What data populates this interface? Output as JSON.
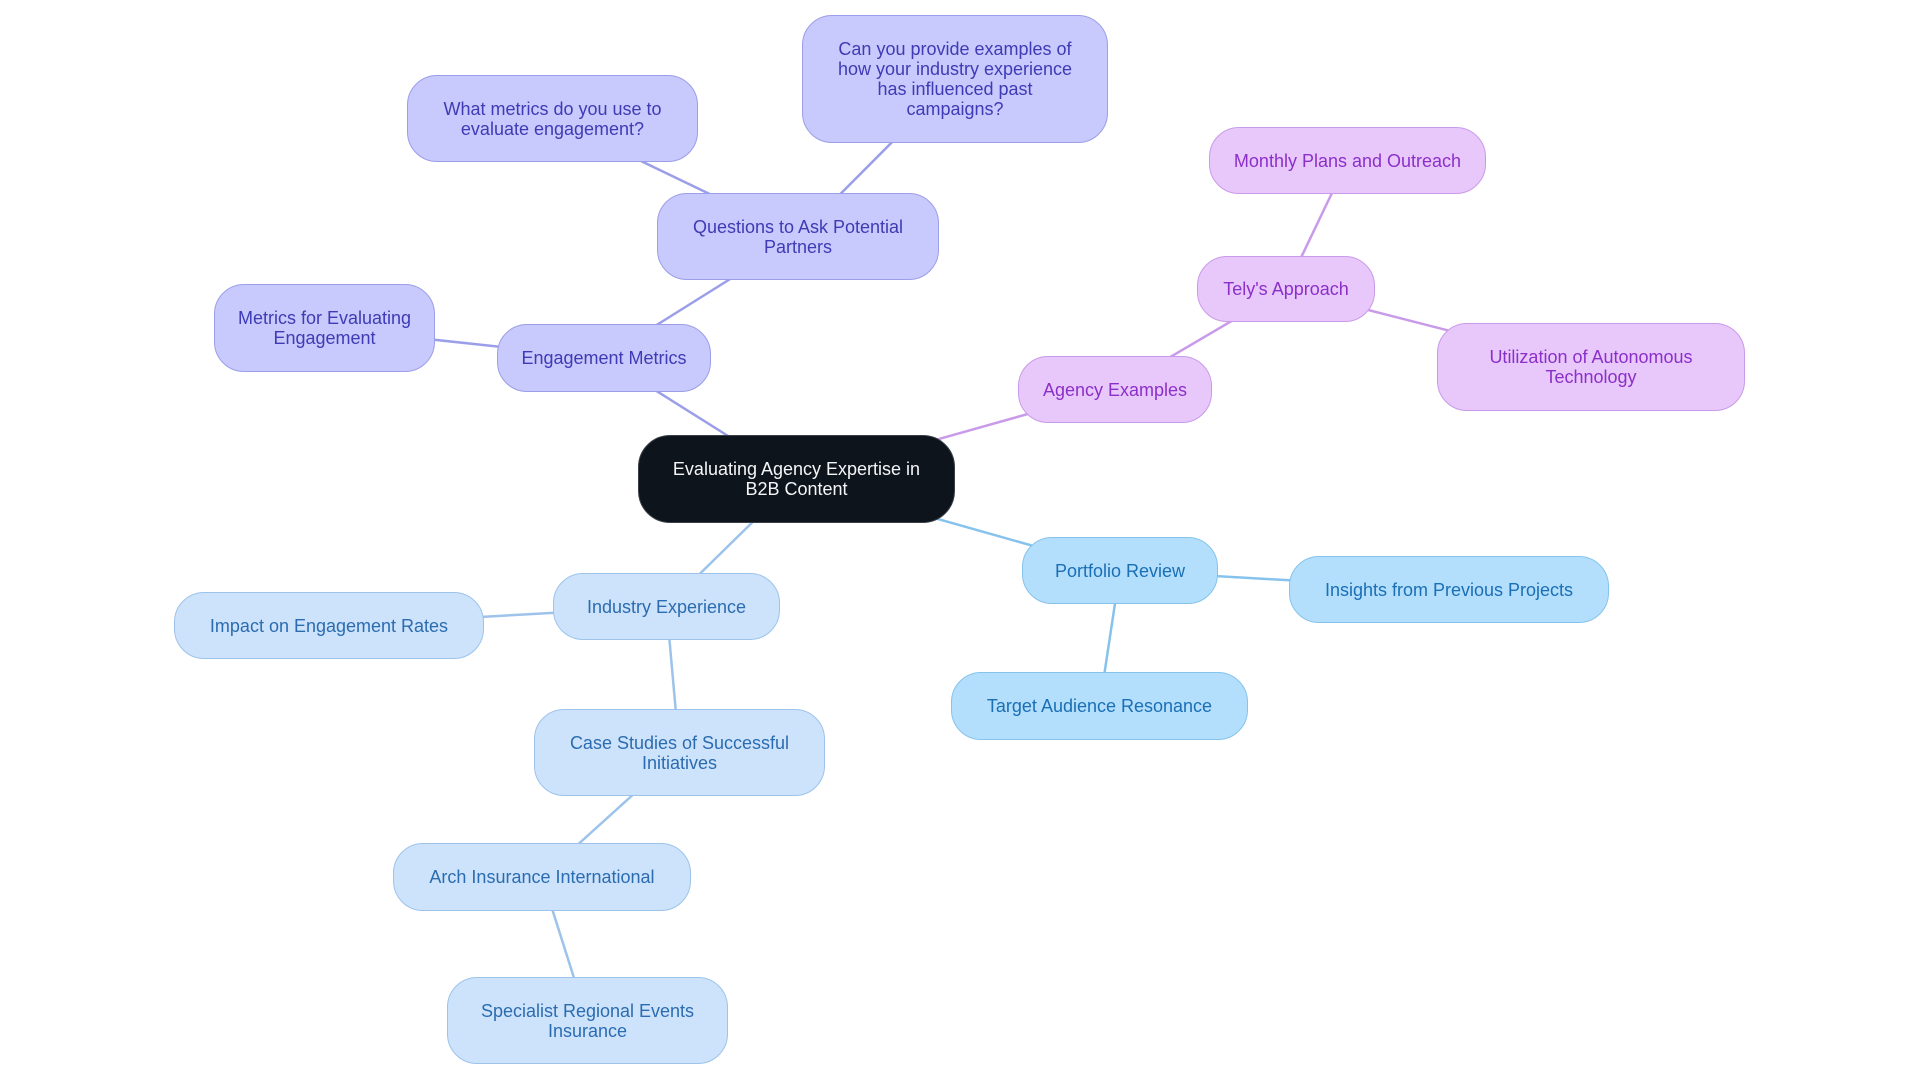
{
  "title": "Evaluating Agency Expertise in B2B Content",
  "colors": {
    "indigo_edge": "#9b9ee8",
    "purple_edge": "#c99ae9",
    "sky_edge": "#86c3ec",
    "pale_edge": "#9dc3ea"
  },
  "nodes": {
    "root": {
      "label": "Evaluating Agency Expertise in\nB2B Content"
    },
    "engagement_metrics": {
      "label": "Engagement Metrics"
    },
    "metrics_for_evaluating": {
      "label": "Metrics for Evaluating\nEngagement"
    },
    "questions_partners": {
      "label": "Questions to Ask Potential\nPartners"
    },
    "what_metrics": {
      "label": "What metrics do you use to\nevaluate engagement?"
    },
    "can_you_provide": {
      "label": "Can you provide examples of\nhow your industry experience\nhas influenced past\ncampaigns?"
    },
    "agency_examples": {
      "label": "Agency Examples"
    },
    "telys_approach": {
      "label": "Tely's Approach"
    },
    "monthly_plans": {
      "label": "Monthly Plans and Outreach"
    },
    "autonomous_tech": {
      "label": "Utilization of Autonomous\nTechnology"
    },
    "portfolio_review": {
      "label": "Portfolio Review"
    },
    "insights_previous": {
      "label": "Insights from Previous Projects"
    },
    "target_audience": {
      "label": "Target Audience Resonance"
    },
    "industry_experience": {
      "label": "Industry Experience"
    },
    "impact_engagement": {
      "label": "Impact on Engagement Rates"
    },
    "case_studies": {
      "label": "Case Studies of Successful\nInitiatives"
    },
    "arch_insurance": {
      "label": "Arch Insurance International"
    },
    "specialist_regional": {
      "label": "Specialist Regional Events\nInsurance"
    }
  },
  "edges": [
    {
      "from": "root",
      "to": "engagement_metrics",
      "branch": "indigo"
    },
    {
      "from": "engagement_metrics",
      "to": "metrics_for_evaluating",
      "branch": "indigo"
    },
    {
      "from": "engagement_metrics",
      "to": "questions_partners",
      "branch": "indigo"
    },
    {
      "from": "questions_partners",
      "to": "what_metrics",
      "branch": "indigo"
    },
    {
      "from": "questions_partners",
      "to": "can_you_provide",
      "branch": "indigo"
    },
    {
      "from": "root",
      "to": "agency_examples",
      "branch": "purple"
    },
    {
      "from": "agency_examples",
      "to": "telys_approach",
      "branch": "purple"
    },
    {
      "from": "telys_approach",
      "to": "monthly_plans",
      "branch": "purple"
    },
    {
      "from": "telys_approach",
      "to": "autonomous_tech",
      "branch": "purple"
    },
    {
      "from": "root",
      "to": "portfolio_review",
      "branch": "sky"
    },
    {
      "from": "portfolio_review",
      "to": "insights_previous",
      "branch": "sky"
    },
    {
      "from": "portfolio_review",
      "to": "target_audience",
      "branch": "sky"
    },
    {
      "from": "root",
      "to": "industry_experience",
      "branch": "pale"
    },
    {
      "from": "industry_experience",
      "to": "impact_engagement",
      "branch": "pale"
    },
    {
      "from": "industry_experience",
      "to": "case_studies",
      "branch": "pale"
    },
    {
      "from": "case_studies",
      "to": "arch_insurance",
      "branch": "pale"
    },
    {
      "from": "arch_insurance",
      "to": "specialist_regional",
      "branch": "pale"
    }
  ]
}
